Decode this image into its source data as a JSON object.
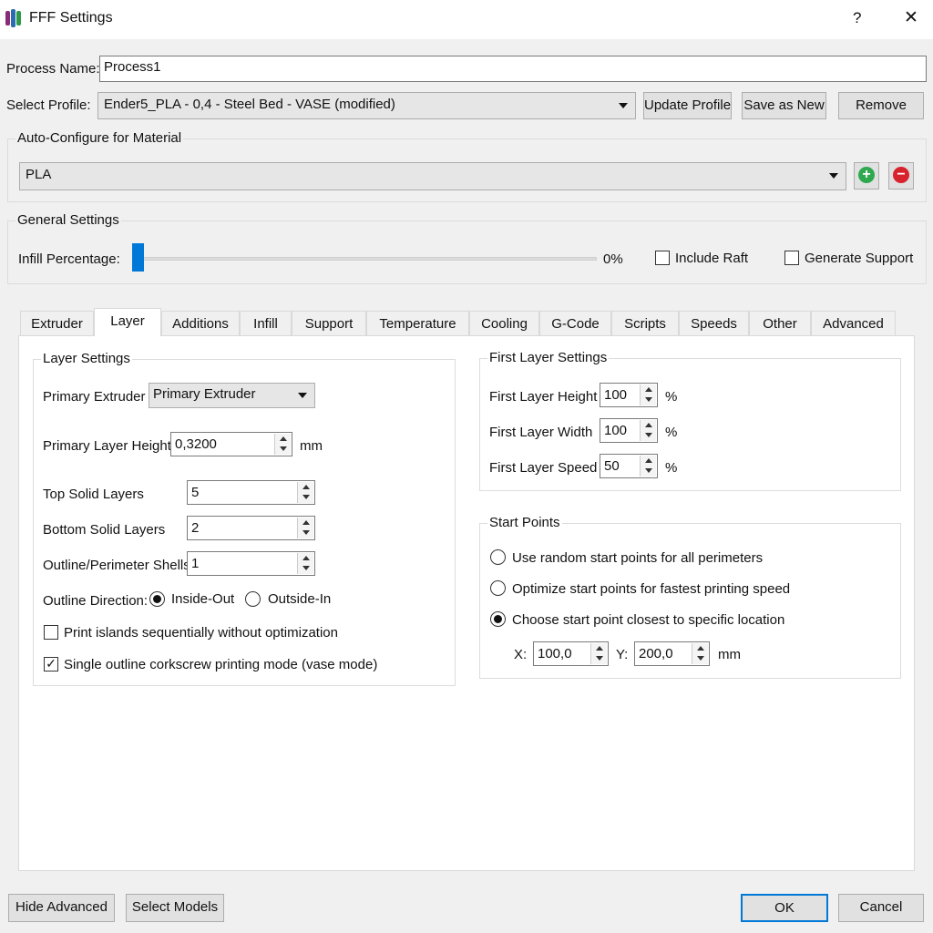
{
  "window": {
    "title": "FFF Settings",
    "help": "?",
    "close": "✕"
  },
  "process_name": {
    "label": "Process Name:",
    "value": "Process1"
  },
  "profile": {
    "label": "Select Profile:",
    "value": "Ender5_PLA - 0,4 - Steel Bed - VASE (modified)",
    "update": "Update Profile",
    "save_new": "Save as New",
    "remove": "Remove"
  },
  "material": {
    "title": "Auto-Configure for Material",
    "value": "PLA"
  },
  "general": {
    "title": "General Settings",
    "infill_label": "Infill Percentage:",
    "infill_value": "0%",
    "infill_fraction": 0,
    "raft": "Include Raft",
    "support": "Generate Support"
  },
  "tabs": [
    "Extruder",
    "Layer",
    "Additions",
    "Infill",
    "Support",
    "Temperature",
    "Cooling",
    "G-Code",
    "Scripts",
    "Speeds",
    "Other",
    "Advanced"
  ],
  "layer": {
    "title": "Layer Settings",
    "primary_extruder_label": "Primary Extruder",
    "primary_extruder_value": "Primary Extruder",
    "layer_height_label": "Primary Layer Height",
    "layer_height_value": "0,3200",
    "layer_height_unit": "mm",
    "top_label": "Top Solid Layers",
    "top_value": "5",
    "bottom_label": "Bottom Solid Layers",
    "bottom_value": "2",
    "shells_label": "Outline/Perimeter Shells",
    "shells_value": "1",
    "direction_label": "Outline Direction:",
    "inside_out": "Inside-Out",
    "outside_in": "Outside-In",
    "islands": "Print islands sequentially without optimization",
    "vase": "Single outline corkscrew printing mode (vase mode)"
  },
  "first_layer": {
    "title": "First Layer Settings",
    "height_label": "First Layer Height",
    "height_value": "100",
    "width_label": "First Layer Width",
    "width_value": "100",
    "speed_label": "First Layer Speed",
    "speed_value": "50",
    "unit": "%"
  },
  "start_points": {
    "title": "Start Points",
    "random": "Use random start points for all perimeters",
    "optimize": "Optimize start points for fastest printing speed",
    "choose": "Choose start point closest to specific location",
    "x_label": "X:",
    "x_value": "100,0",
    "y_label": "Y:",
    "y_value": "200,0",
    "unit": "mm"
  },
  "footer": {
    "hide_advanced": "Hide Advanced",
    "select_models": "Select Models",
    "ok": "OK",
    "cancel": "Cancel"
  }
}
